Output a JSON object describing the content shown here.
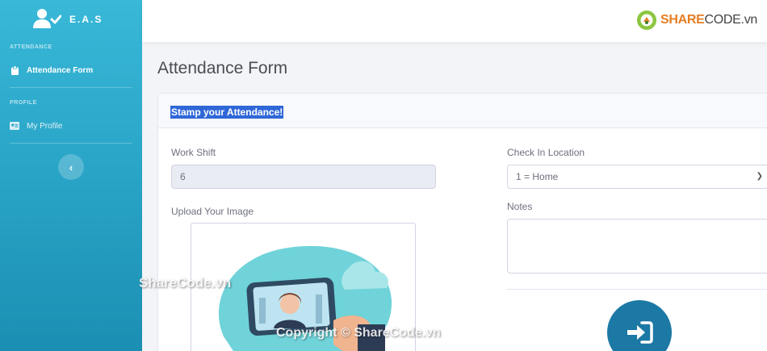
{
  "brand": {
    "name": "E.A.S",
    "icon": "user-check-icon"
  },
  "sidebar": {
    "sections": [
      {
        "heading": "ATTENDANCE",
        "items": [
          {
            "label": "Attendance Form",
            "icon": "clipboard-icon",
            "active": true
          }
        ]
      },
      {
        "heading": "PROFILE",
        "items": [
          {
            "label": "My Profile",
            "icon": "id-card-icon",
            "active": false
          }
        ]
      }
    ],
    "toggle_icon": "chevron-left-icon"
  },
  "topbar": {
    "logo_prefix": "SHARE",
    "logo_suffix": "CODE.vn"
  },
  "page": {
    "title": "Attendance Form"
  },
  "card": {
    "header": "Stamp your Attendance!",
    "work_shift": {
      "label": "Work Shift",
      "value": "6"
    },
    "check_in_location": {
      "label": "Check In Location",
      "value": "1 = Home"
    },
    "upload": {
      "label": "Upload Your Image"
    },
    "notes": {
      "label": "Notes",
      "value": ""
    },
    "submit_icon": "sign-in-icon"
  },
  "watermarks": {
    "left": "ShareCode.vn",
    "bottom": "Copyright © ShareCode.vn"
  },
  "colors": {
    "sidebar": "#2aa6c8",
    "submit": "#1c78a5",
    "highlight": "#2f67d8",
    "logo": "#e67e22"
  }
}
